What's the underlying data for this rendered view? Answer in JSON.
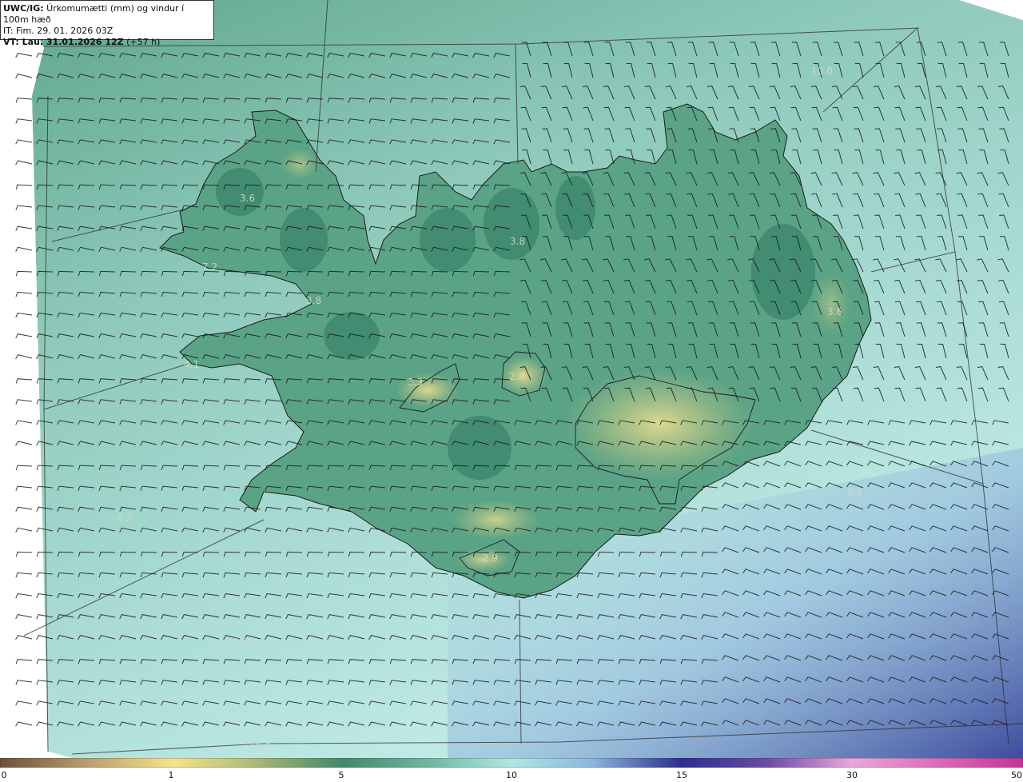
{
  "header": {
    "model": "UWC/IG:",
    "title": " Úrkomumætti (mm) og vindur í 100m hæð",
    "init_time": "IT: Fim. 29. 01. 2026 03Z",
    "valid_prefix": "VT:",
    "valid_time": " Lau. 31.01.2026 12Z",
    "lead": " (+57 h)"
  },
  "value_labels": [
    "3.6",
    "7.2",
    "3.8",
    "3.8",
    "4.1",
    "3.3",
    "2.3",
    "3.6",
    "2.9",
    "6.2",
    "7.6",
    "10.6",
    "10.0",
    "5.9"
  ],
  "colorbar": {
    "ticks": [
      "0",
      "1",
      "5",
      "10",
      "15",
      "30",
      "50"
    ],
    "colors": [
      "#7b5f3f",
      "#f5e48c",
      "#3f8a6a",
      "#aee7e4",
      "#2b2f8f",
      "#e9a7dc",
      "#c7329a"
    ]
  },
  "colors": {
    "ocean": "#a5d7cf",
    "land": "#5aa386",
    "highland": "#d6d489",
    "deep_precip": "#2f3b96"
  }
}
